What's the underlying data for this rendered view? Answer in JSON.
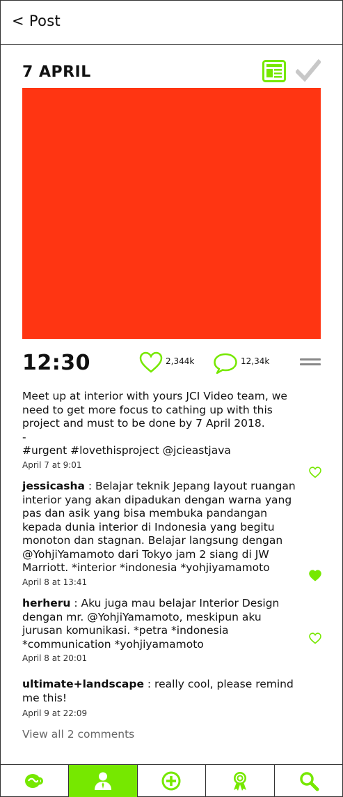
{
  "header": {
    "back_label": "< Post"
  },
  "post": {
    "date": "7 APRIL",
    "time": "12:30",
    "likes": "2,344k",
    "comments_count": "12,34k",
    "image_color": "#ff3512",
    "caption": "Meet up at interior with yours JCI Video team, we need to get more focus to cathing up with this project and must to be done by 7 April 2018.",
    "caption_dash": "-",
    "hashtags": "#urgent #lovethisproject @jcieastjava",
    "posted_at": "April 7 at 9:01"
  },
  "comments": [
    {
      "user": "jessicasha",
      "text": " : Belajar teknik Jepang layout ruangan interior yang akan dipadukan dengan warna yang pas dan asik yang bisa membuka pandangan kepada dunia interior di Indonesia yang begitu monoton dan stagnan. Belajar langsung dengan @YohjiYamamoto dari Tokyo jam 2 siang di JW Marriott. *interior *indonesia *yohjiyamamoto",
      "time": "April 8 at 13:41"
    },
    {
      "user": "herheru",
      "text": " : Aku juga mau belajar Interior Design dengan mr. @YohjiYamamoto, meskipun aku jurusan komunikasi. *petra *indonesia *communication *yohjiyamamoto",
      "time": "April 8 at 20:01"
    },
    {
      "user": "ultimate+landscape",
      "text": " : really cool, please remind me this!",
      "time": "April 9 at 22:09"
    }
  ],
  "view_all_label": "View all 2 comments",
  "colors": {
    "accent": "#76e800",
    "image": "#ff3512",
    "check": "#c8c8c8"
  },
  "icons": {
    "news": "newspaper-icon",
    "check": "check-icon",
    "like": "heart-icon",
    "comment": "speech-bubble-icon",
    "menu": "menu-icon",
    "tabs": [
      "coffee-cup-icon",
      "person-icon",
      "add-circle-icon",
      "award-ribbon-icon",
      "search-icon"
    ]
  },
  "tabs": {
    "active_index": 1
  }
}
